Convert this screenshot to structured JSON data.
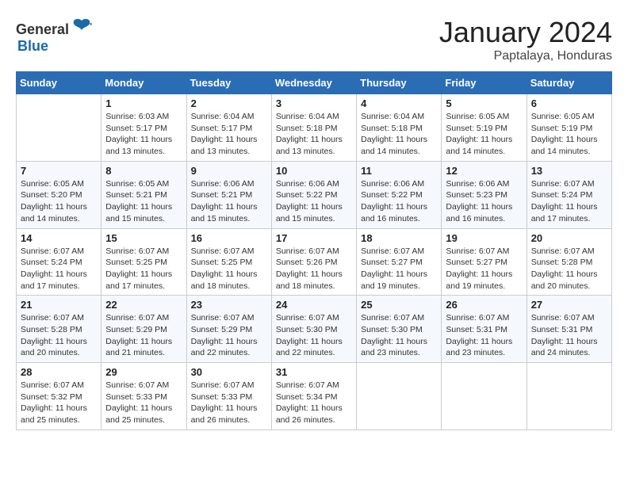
{
  "header": {
    "logo_general": "General",
    "logo_blue": "Blue",
    "month_title": "January 2024",
    "location": "Paptalaya, Honduras"
  },
  "weekdays": [
    "Sunday",
    "Monday",
    "Tuesday",
    "Wednesday",
    "Thursday",
    "Friday",
    "Saturday"
  ],
  "weeks": [
    [
      {
        "day": "",
        "sunrise": "",
        "sunset": "",
        "daylight": ""
      },
      {
        "day": "1",
        "sunrise": "6:03 AM",
        "sunset": "5:17 PM",
        "daylight": "11 hours and 13 minutes."
      },
      {
        "day": "2",
        "sunrise": "6:04 AM",
        "sunset": "5:17 PM",
        "daylight": "11 hours and 13 minutes."
      },
      {
        "day": "3",
        "sunrise": "6:04 AM",
        "sunset": "5:18 PM",
        "daylight": "11 hours and 13 minutes."
      },
      {
        "day": "4",
        "sunrise": "6:04 AM",
        "sunset": "5:18 PM",
        "daylight": "11 hours and 14 minutes."
      },
      {
        "day": "5",
        "sunrise": "6:05 AM",
        "sunset": "5:19 PM",
        "daylight": "11 hours and 14 minutes."
      },
      {
        "day": "6",
        "sunrise": "6:05 AM",
        "sunset": "5:19 PM",
        "daylight": "11 hours and 14 minutes."
      }
    ],
    [
      {
        "day": "7",
        "sunrise": "6:05 AM",
        "sunset": "5:20 PM",
        "daylight": "11 hours and 14 minutes."
      },
      {
        "day": "8",
        "sunrise": "6:05 AM",
        "sunset": "5:21 PM",
        "daylight": "11 hours and 15 minutes."
      },
      {
        "day": "9",
        "sunrise": "6:06 AM",
        "sunset": "5:21 PM",
        "daylight": "11 hours and 15 minutes."
      },
      {
        "day": "10",
        "sunrise": "6:06 AM",
        "sunset": "5:22 PM",
        "daylight": "11 hours and 15 minutes."
      },
      {
        "day": "11",
        "sunrise": "6:06 AM",
        "sunset": "5:22 PM",
        "daylight": "11 hours and 16 minutes."
      },
      {
        "day": "12",
        "sunrise": "6:06 AM",
        "sunset": "5:23 PM",
        "daylight": "11 hours and 16 minutes."
      },
      {
        "day": "13",
        "sunrise": "6:07 AM",
        "sunset": "5:24 PM",
        "daylight": "11 hours and 17 minutes."
      }
    ],
    [
      {
        "day": "14",
        "sunrise": "6:07 AM",
        "sunset": "5:24 PM",
        "daylight": "11 hours and 17 minutes."
      },
      {
        "day": "15",
        "sunrise": "6:07 AM",
        "sunset": "5:25 PM",
        "daylight": "11 hours and 17 minutes."
      },
      {
        "day": "16",
        "sunrise": "6:07 AM",
        "sunset": "5:25 PM",
        "daylight": "11 hours and 18 minutes."
      },
      {
        "day": "17",
        "sunrise": "6:07 AM",
        "sunset": "5:26 PM",
        "daylight": "11 hours and 18 minutes."
      },
      {
        "day": "18",
        "sunrise": "6:07 AM",
        "sunset": "5:27 PM",
        "daylight": "11 hours and 19 minutes."
      },
      {
        "day": "19",
        "sunrise": "6:07 AM",
        "sunset": "5:27 PM",
        "daylight": "11 hours and 19 minutes."
      },
      {
        "day": "20",
        "sunrise": "6:07 AM",
        "sunset": "5:28 PM",
        "daylight": "11 hours and 20 minutes."
      }
    ],
    [
      {
        "day": "21",
        "sunrise": "6:07 AM",
        "sunset": "5:28 PM",
        "daylight": "11 hours and 20 minutes."
      },
      {
        "day": "22",
        "sunrise": "6:07 AM",
        "sunset": "5:29 PM",
        "daylight": "11 hours and 21 minutes."
      },
      {
        "day": "23",
        "sunrise": "6:07 AM",
        "sunset": "5:29 PM",
        "daylight": "11 hours and 22 minutes."
      },
      {
        "day": "24",
        "sunrise": "6:07 AM",
        "sunset": "5:30 PM",
        "daylight": "11 hours and 22 minutes."
      },
      {
        "day": "25",
        "sunrise": "6:07 AM",
        "sunset": "5:30 PM",
        "daylight": "11 hours and 23 minutes."
      },
      {
        "day": "26",
        "sunrise": "6:07 AM",
        "sunset": "5:31 PM",
        "daylight": "11 hours and 23 minutes."
      },
      {
        "day": "27",
        "sunrise": "6:07 AM",
        "sunset": "5:31 PM",
        "daylight": "11 hours and 24 minutes."
      }
    ],
    [
      {
        "day": "28",
        "sunrise": "6:07 AM",
        "sunset": "5:32 PM",
        "daylight": "11 hours and 25 minutes."
      },
      {
        "day": "29",
        "sunrise": "6:07 AM",
        "sunset": "5:33 PM",
        "daylight": "11 hours and 25 minutes."
      },
      {
        "day": "30",
        "sunrise": "6:07 AM",
        "sunset": "5:33 PM",
        "daylight": "11 hours and 26 minutes."
      },
      {
        "day": "31",
        "sunrise": "6:07 AM",
        "sunset": "5:34 PM",
        "daylight": "11 hours and 26 minutes."
      },
      {
        "day": "",
        "sunrise": "",
        "sunset": "",
        "daylight": ""
      },
      {
        "day": "",
        "sunrise": "",
        "sunset": "",
        "daylight": ""
      },
      {
        "day": "",
        "sunrise": "",
        "sunset": "",
        "daylight": ""
      }
    ]
  ],
  "labels": {
    "sunrise_prefix": "Sunrise: ",
    "sunset_prefix": "Sunset: ",
    "daylight_prefix": "Daylight: "
  }
}
